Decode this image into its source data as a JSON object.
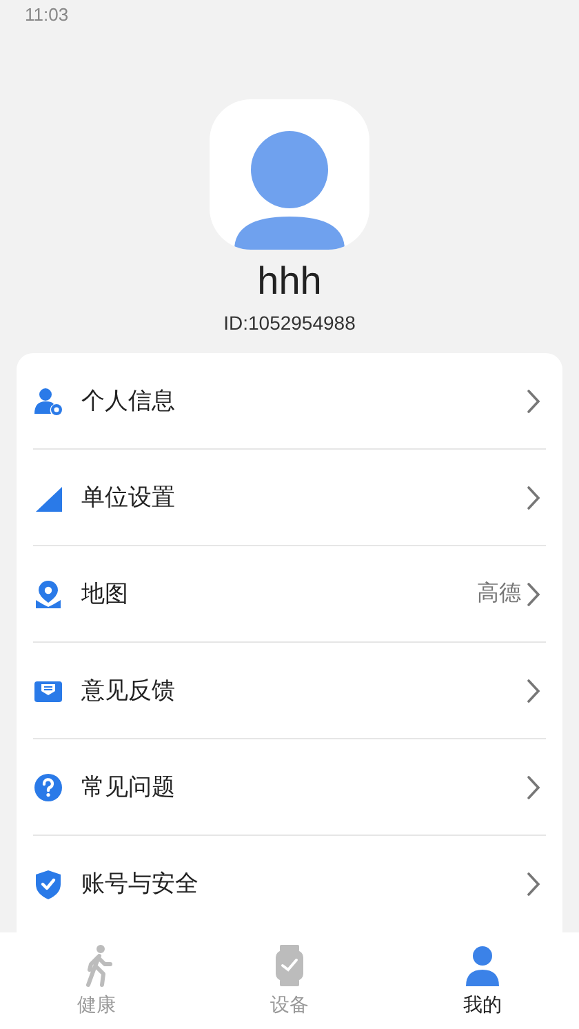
{
  "status_bar": {
    "time": "11:03"
  },
  "profile": {
    "name": "hhh",
    "id": "ID:1052954988"
  },
  "menu": [
    {
      "kind": "person",
      "label": "个人信息"
    },
    {
      "kind": "triangle",
      "label": "单位设置"
    },
    {
      "kind": "map",
      "label": "地图",
      "value": "高德"
    },
    {
      "kind": "mail",
      "label": "意见反馈"
    },
    {
      "kind": "question",
      "label": "常见问题"
    },
    {
      "kind": "shield",
      "label": "账号与安全"
    }
  ],
  "tabs": [
    {
      "kind": "walk",
      "label": "健康",
      "selected": false
    },
    {
      "kind": "watch",
      "label": "设备",
      "selected": false
    },
    {
      "kind": "me",
      "label": "我的",
      "selected": true
    }
  ]
}
